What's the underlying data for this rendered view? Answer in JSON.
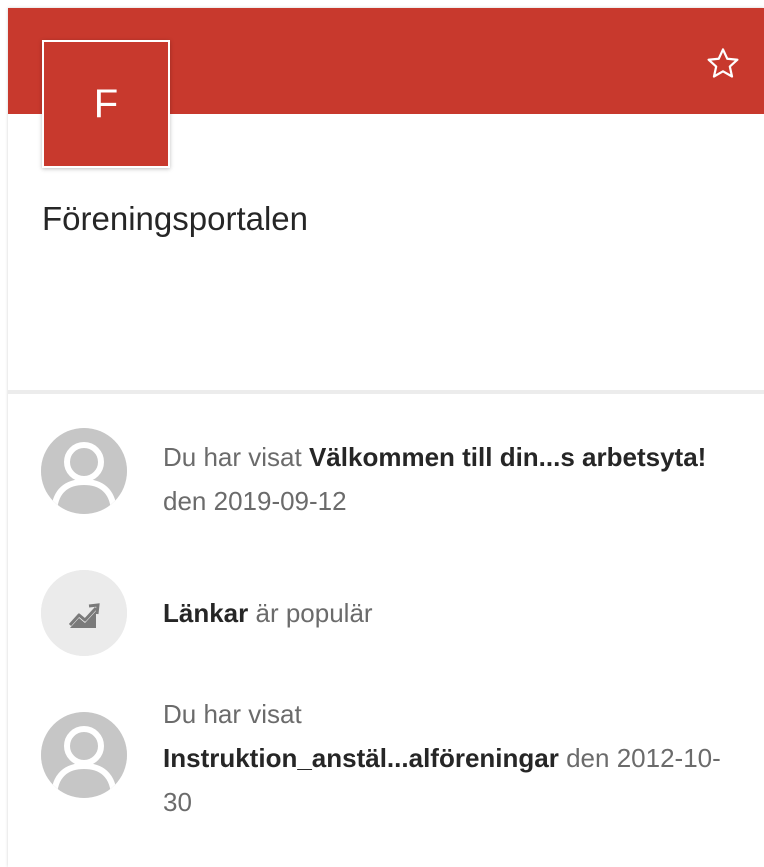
{
  "header": {
    "logo_letter": "F",
    "site_title": "Föreningsportalen",
    "brand_color": "#c8392d",
    "follow_icon": "star-outline-icon"
  },
  "activity": [
    {
      "icon": "person-avatar-icon",
      "prefix": "Du har visat",
      "item": "Välkommen till din...s arbetsyta!",
      "suffix": "den 2019-09-12"
    },
    {
      "icon": "trending-chart-icon",
      "item": "Länkar",
      "suffix": "är populär"
    },
    {
      "icon": "person-avatar-icon",
      "prefix": "Du har visat",
      "item": "Instruktion_anstäl...alföreningar",
      "suffix": "den 2012-10-30"
    }
  ]
}
